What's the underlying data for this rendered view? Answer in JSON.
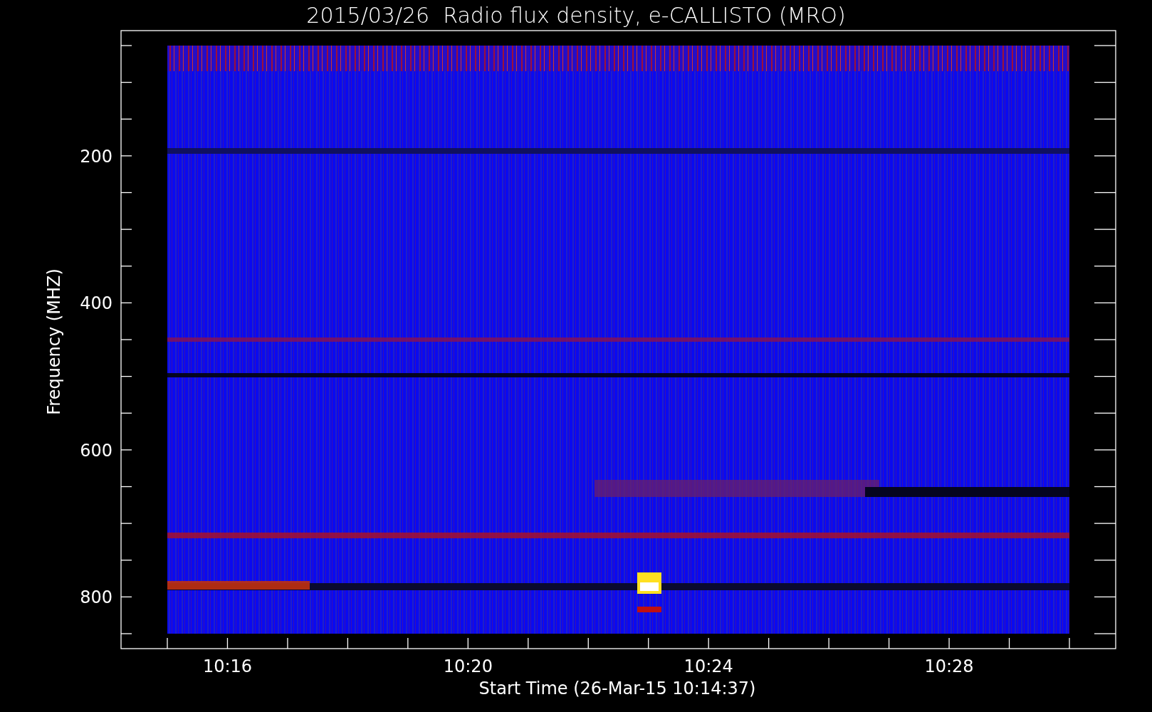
{
  "title": "2015/03/26  Radio flux density, e-CALLISTO (MRO)",
  "y_axis": {
    "label": "Frequency (MHZ)",
    "tick_labels": [
      "200",
      "400",
      "600",
      "800"
    ]
  },
  "x_axis": {
    "label": "Start Time (26-Mar-15 10:14:37)",
    "tick_labels": [
      "10:16",
      "10:20",
      "10:24",
      "10:28"
    ]
  }
}
